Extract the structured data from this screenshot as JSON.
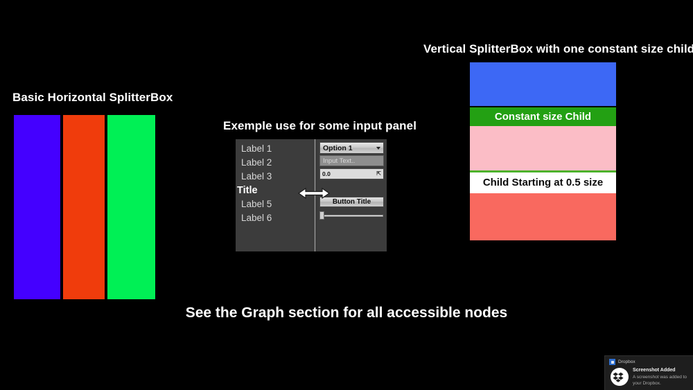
{
  "horizontal_splitter": {
    "title": "Basic Horizontal SplitterBox",
    "panes": [
      {
        "name": "blue-pane",
        "color": "#4400FF",
        "flex": 34
      },
      {
        "name": "orange-pane",
        "color": "#F03C0C",
        "flex": 31
      },
      {
        "name": "green-pane",
        "color": "#00F055",
        "flex": 35
      }
    ]
  },
  "input_panel": {
    "title": "Exemple use for some input panel",
    "labels": [
      {
        "text": "Label 1",
        "bold": false
      },
      {
        "text": "Label 2",
        "bold": false
      },
      {
        "text": "Label 3",
        "bold": false
      },
      {
        "text": "Title",
        "bold": true
      },
      {
        "text": "Label 5",
        "bold": false
      },
      {
        "text": "Label 6",
        "bold": false
      }
    ],
    "combo_value": "Option 1",
    "text_input_placeholder": "Input Text..",
    "spin_value": "0.0",
    "button_label": "Button Title",
    "slider_value": 0,
    "cursor_icon": "horizontal-resize-arrow"
  },
  "vertical_splitter": {
    "title": "Vertical SplitterBox with one constant size child",
    "panes": [
      {
        "name": "blue-pane",
        "color": "#3D68F5",
        "label": "",
        "text_color": "#ffffff",
        "height": 63
      },
      {
        "name": "constant-size-child",
        "color": "#23A013",
        "label": "Constant size Child",
        "text_color": "#ffffff",
        "height": 28
      },
      {
        "name": "pink-pane",
        "color": "#FBBDC6",
        "label": "",
        "text_color": "#000000",
        "height": 64
      },
      {
        "name": "thin-green-divider",
        "color": "#4CB22B",
        "label": "",
        "text_color": "#000000",
        "height": 3
      },
      {
        "name": "half-size-child",
        "color": "#FFFFFF",
        "label": "Child Starting at 0.5 size",
        "text_color": "#0b0b0b",
        "height": 30
      },
      {
        "name": "red-pane",
        "color": "#F9695F",
        "label": "",
        "text_color": "#000000",
        "height": 69
      }
    ]
  },
  "footer": {
    "note": "See the Graph section for all accessible nodes"
  },
  "dropbox_toast": {
    "app_name": "Dropbox",
    "title": "Screenshot Added",
    "message": "A screenshot was added to your Dropbox.",
    "accent": "#2f6fd0"
  }
}
